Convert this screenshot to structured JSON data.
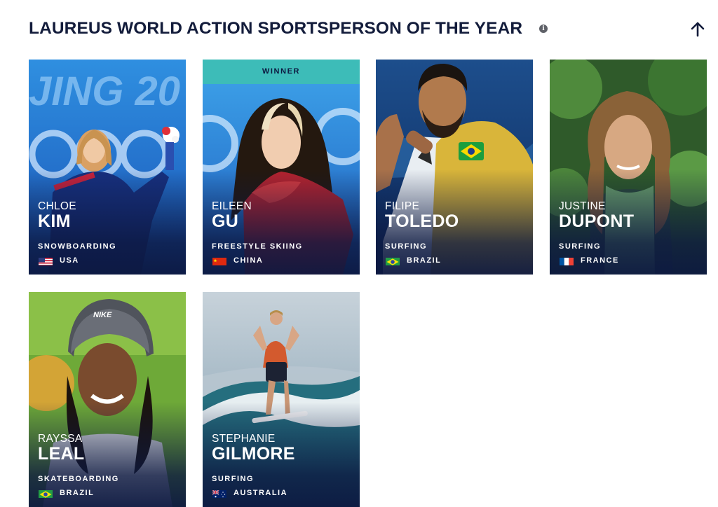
{
  "section": {
    "title": "LAUREUS WORLD ACTION SPORTSPERSON OF THE YEAR",
    "info_icon": "info-icon",
    "collapse_icon": "arrow-up-icon"
  },
  "nominees": [
    {
      "first_name": "CHLOE",
      "last_name": "KIM",
      "sport": "SNOWBOARDING",
      "country": "USA",
      "flag": "flag-usa-icon"
    },
    {
      "badge": "WINNER",
      "first_name": "EILEEN",
      "last_name": "GU",
      "sport": "FREESTYLE SKIING",
      "country": "CHINA",
      "flag": "flag-china-icon"
    },
    {
      "first_name": "FILIPE",
      "last_name": "TOLEDO",
      "sport": "SURFING",
      "country": "BRAZIL",
      "flag": "flag-brazil-icon"
    },
    {
      "first_name": "JUSTINE",
      "last_name": "DUPONT",
      "sport": "SURFING",
      "country": "FRANCE",
      "flag": "flag-france-icon"
    },
    {
      "first_name": "RAYSSA",
      "last_name": "LEAL",
      "sport": "SKATEBOARDING",
      "country": "BRAZIL",
      "flag": "flag-brazil-icon"
    },
    {
      "first_name": "STEPHANIE",
      "last_name": "GILMORE",
      "sport": "SURFING",
      "country": "AUSTRALIA",
      "flag": "flag-australia-icon"
    }
  ],
  "colors": {
    "navy": "#131c3b",
    "winner_teal": "#3dbcb8"
  }
}
